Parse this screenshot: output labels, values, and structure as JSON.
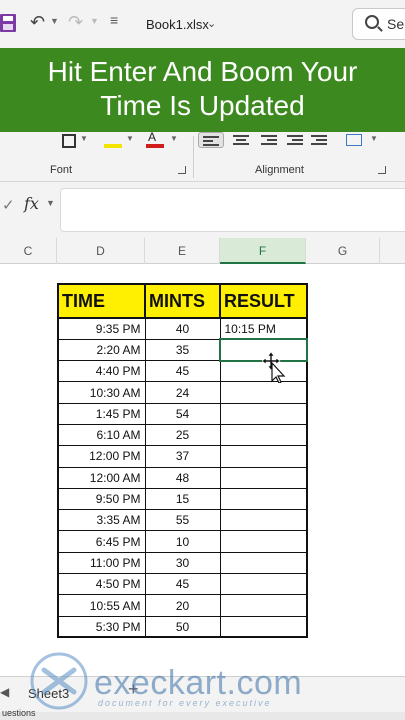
{
  "titlebar": {
    "filename": "Book1.xlsx",
    "search_partial": "Se",
    "qat_more": "≡"
  },
  "banner": {
    "line1": "Hit Enter And Boom Your",
    "line2": "Time Is Updated",
    "color": "#3c8a1f"
  },
  "ribbon": {
    "font_group": "Font",
    "alignment_group": "Alignment",
    "font_color_letter": "A",
    "fill_color": "#f5e400",
    "font_color": "#d11c1c"
  },
  "formula_bar": {
    "fx": "fx",
    "value": ""
  },
  "columns": [
    "C",
    "D",
    "E",
    "F",
    "G"
  ],
  "active_column": "F",
  "table": {
    "headers": [
      "TIME",
      "MINTS",
      "RESULT"
    ],
    "header_color": "#ffef00",
    "rows": [
      {
        "time": "9:35 PM",
        "mints": "40",
        "result": "10:15 PM"
      },
      {
        "time": "2:20 AM",
        "mints": "35",
        "result": ""
      },
      {
        "time": "4:40 PM",
        "mints": "45",
        "result": ""
      },
      {
        "time": "10:30 AM",
        "mints": "24",
        "result": ""
      },
      {
        "time": "1:45 PM",
        "mints": "54",
        "result": ""
      },
      {
        "time": "6:10 AM",
        "mints": "25",
        "result": ""
      },
      {
        "time": "12:00 PM",
        "mints": "37",
        "result": ""
      },
      {
        "time": "12:00 AM",
        "mints": "48",
        "result": ""
      },
      {
        "time": "9:50 PM",
        "mints": "15",
        "result": ""
      },
      {
        "time": "3:35 AM",
        "mints": "55",
        "result": ""
      },
      {
        "time": "6:45 PM",
        "mints": "10",
        "result": ""
      },
      {
        "time": "11:00 PM",
        "mints": "30",
        "result": ""
      },
      {
        "time": "4:50 PM",
        "mints": "45",
        "result": ""
      },
      {
        "time": "10:55 AM",
        "mints": "20",
        "result": ""
      },
      {
        "time": "5:30 PM",
        "mints": "50",
        "result": ""
      }
    ]
  },
  "sheets": {
    "active": "Sheet3",
    "add": "+"
  },
  "statusbar": {
    "text": "uestions"
  },
  "watermark": {
    "brand": "execkart.com",
    "tagline": "document for every executive"
  }
}
